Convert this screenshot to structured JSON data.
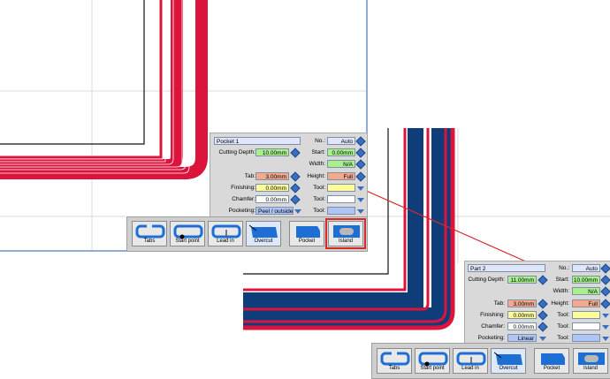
{
  "colors": {
    "red_outline": "#dc143c",
    "blue_outline": "#0f3d79",
    "field_green": "#a8f08c",
    "field_orange": "#f5a98c",
    "field_yellow": "#ffff99",
    "field_blue": "#aec4f5",
    "field_white": "#ffffff",
    "highlight": "#d42a2a"
  },
  "panel1": {
    "name": "Pocket 1",
    "cutting_depth_label": "Cutting Depth:",
    "cutting_depth": "10.00mm",
    "tab_label": "Tab:",
    "tab": "3.00mm",
    "finishing_label": "Finishing:",
    "finishing": "0.00mm",
    "chamfer_label": "Chamfer:",
    "chamfer": "0.00mm",
    "pocketing_label": "Pocketing:",
    "pocketing": "Peel / outside",
    "no_label": "No.:",
    "no": "Auto",
    "start_label": "Start:",
    "start": "0.00mm",
    "width_label": "Width:",
    "width": "N/A",
    "height_label": "Height:",
    "height": "Full",
    "tool1_label": "Tool:",
    "tool2_label": "Tool:",
    "tool3_label": "Tool:",
    "buttons": [
      {
        "label": "Tabs",
        "icon": "tabs-icon"
      },
      {
        "label": "Start point",
        "icon": "start-point-icon"
      },
      {
        "label": "Lead in",
        "icon": "lead-in-icon"
      },
      {
        "label": "Overcut",
        "icon": "overcut-icon"
      },
      {
        "label": "Pocket",
        "icon": "pocket-icon"
      },
      {
        "label": "Island",
        "icon": "island-icon"
      }
    ]
  },
  "panel2": {
    "name": "Part 2",
    "cutting_depth_label": "Cutting Depth:",
    "cutting_depth": "11.00mm",
    "tab_label": "Tab:",
    "tab": "3.00mm",
    "finishing_label": "Finishing:",
    "finishing": "0.00mm",
    "chamfer_label": "Chamfer:",
    "chamfer": "0.00mm",
    "pocketing_label": "Pocketing:",
    "pocketing": "Linear",
    "no_label": "No.:",
    "no": "Auto",
    "start_label": "Start:",
    "start": "10.00mm",
    "width_label": "Width:",
    "width": "N/A",
    "height_label": "Height:",
    "height": "Full",
    "tool1_label": "Tool:",
    "tool2_label": "Tool:",
    "tool3_label": "Tool:",
    "buttons": [
      {
        "label": "Tabs",
        "icon": "tabs-icon"
      },
      {
        "label": "Start point",
        "icon": "start-point-icon"
      },
      {
        "label": "Lead in",
        "icon": "lead-in-icon"
      },
      {
        "label": "Overcut",
        "icon": "overcut-icon"
      },
      {
        "label": "Pocket",
        "icon": "pocket-icon"
      },
      {
        "label": "Island",
        "icon": "island-icon"
      }
    ]
  }
}
